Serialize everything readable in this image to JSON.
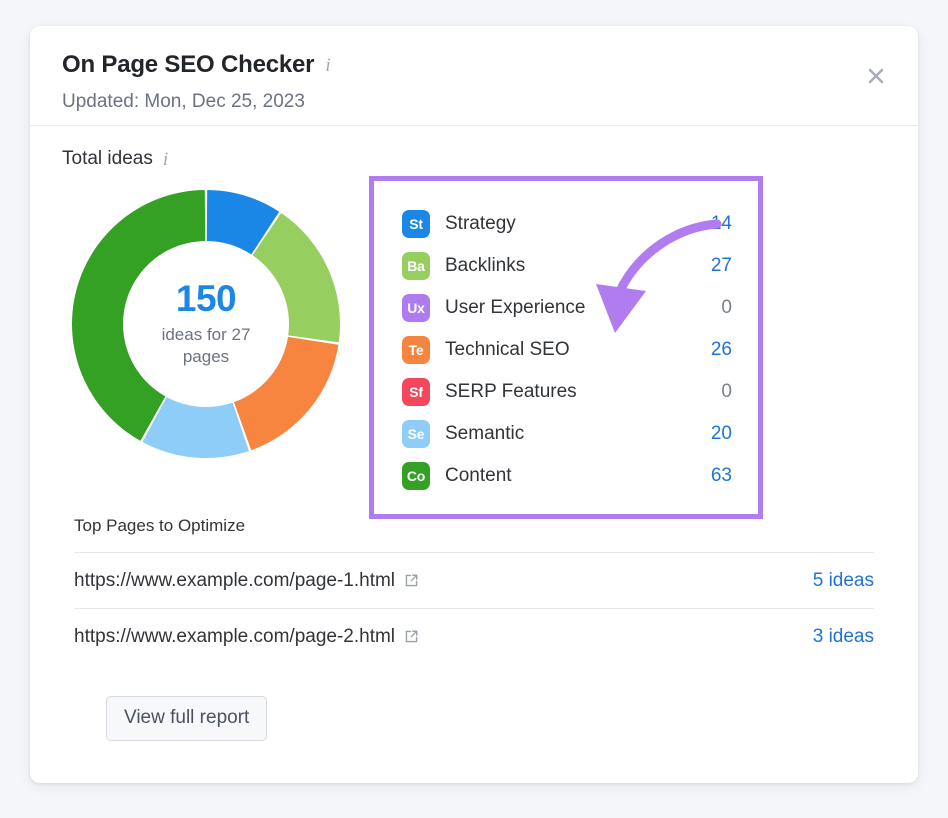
{
  "header": {
    "title": "On Page SEO Checker",
    "info_icon": "info-icon",
    "updated": "Updated: Mon, Dec 25, 2023",
    "close_icon": "close-icon"
  },
  "overview": {
    "section_label": "Total ideas",
    "info_icon": "info-icon"
  },
  "chart_data": {
    "type": "pie",
    "title": "Total ideas",
    "center_total": "150",
    "center_subtitle": "ideas for 27 pages",
    "total": 150,
    "pages": 27,
    "categories": [
      "Strategy",
      "Backlinks",
      "User Experience",
      "Technical SEO",
      "SERP Features",
      "Semantic",
      "Content"
    ],
    "values": [
      14,
      27,
      0,
      26,
      0,
      20,
      63
    ],
    "colors": [
      "#1a87e6",
      "#96cf5f",
      "#ae7cf0",
      "#f7853f",
      "#f4475c",
      "#8ecdf7",
      "#34a125"
    ],
    "legend_position": "right",
    "donut": true,
    "start_angle": 0
  },
  "legend": {
    "items": [
      {
        "abbr": "St",
        "label": "Strategy",
        "value": "14",
        "color": "#1a87e6",
        "is_zero": false
      },
      {
        "abbr": "Ba",
        "label": "Backlinks",
        "value": "27",
        "color": "#96cf5f",
        "is_zero": false
      },
      {
        "abbr": "Ux",
        "label": "User Experience",
        "value": "0",
        "color": "#ae7cf0",
        "is_zero": true
      },
      {
        "abbr": "Te",
        "label": "Technical SEO",
        "value": "26",
        "color": "#f7853f",
        "is_zero": false
      },
      {
        "abbr": "Sf",
        "label": "SERP Features",
        "value": "0",
        "color": "#f4475c",
        "is_zero": true
      },
      {
        "abbr": "Se",
        "label": "Semantic",
        "value": "20",
        "color": "#8ecdf7",
        "is_zero": false
      },
      {
        "abbr": "Co",
        "label": "Content",
        "value": "63",
        "color": "#34a125",
        "is_zero": false
      }
    ],
    "highlight_color": "#b07cf0"
  },
  "annotation": {
    "arrow_icon": "curved-arrow-icon",
    "color": "#b07cf0"
  },
  "top_pages": {
    "title": "Top Pages to Optimize",
    "rows": [
      {
        "url": "https://www.example.com/page-1.html",
        "ideas": "5 ideas",
        "ext_icon": "external-link-icon"
      },
      {
        "url": "https://www.example.com/page-2.html",
        "ideas": "3 ideas",
        "ext_icon": "external-link-icon"
      }
    ]
  },
  "footer": {
    "view_report_label": "View full report"
  }
}
